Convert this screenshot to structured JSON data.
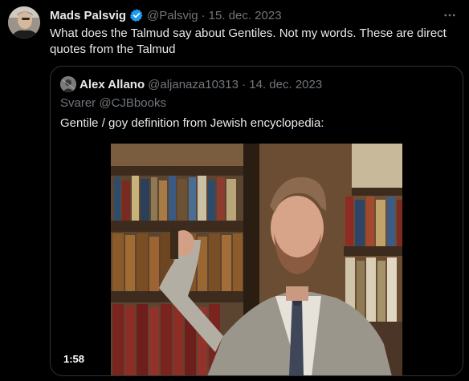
{
  "tweet": {
    "author_name": "Mads Palsvig",
    "handle": "@Palsvig",
    "separator": "·",
    "date": "15. dec. 2023",
    "text": "What does the Talmud say about Gentiles. Not my words. These are direct quotes from the Talmud",
    "more_icon": "more-horizontal-icon",
    "verified_icon": "verified-badge-icon",
    "colors": {
      "verified": "#1d9bf0",
      "muted": "#71767b",
      "text": "#e7e9ea",
      "border": "#2f3336"
    }
  },
  "quote": {
    "author_name": "Alex Allano",
    "handle": "@aljanaza10313 · 14. dec. 2023",
    "reply_to": "Svarer @CJBbooks",
    "text": "Gentile / goy definition from Jewish encyclopedia:",
    "video": {
      "duration": "1:58"
    }
  }
}
